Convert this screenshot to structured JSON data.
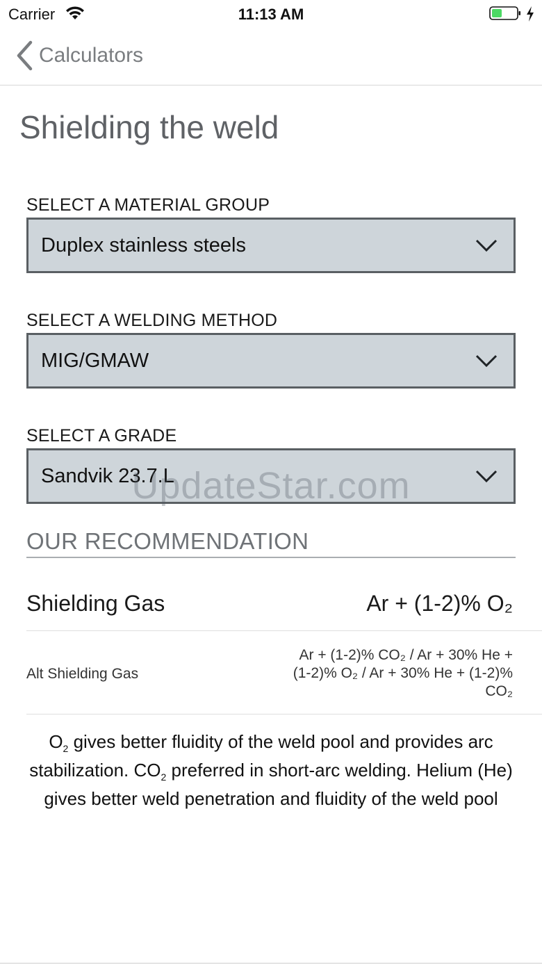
{
  "status_bar": {
    "carrier": "Carrier",
    "time": "11:13 AM"
  },
  "nav": {
    "back_label": "Calculators"
  },
  "page": {
    "title": "Shielding the weld"
  },
  "selects": [
    {
      "label": "SELECT A MATERIAL GROUP",
      "value": "Duplex stainless steels"
    },
    {
      "label": "SELECT A WELDING METHOD",
      "value": "MIG/GMAW"
    },
    {
      "label": "SELECT A GRADE",
      "value": "Sandvik 23.7.L"
    }
  ],
  "recommendation": {
    "heading": "OUR RECOMMENDATION",
    "shielding_gas_label": "Shielding Gas",
    "shielding_gas_value": "Ar + (1-2)% O₂",
    "alt_label": "Alt Shielding Gas",
    "alt_value": "Ar + (1-2)% CO₂ / Ar + 30% He + (1-2)% O₂ / Ar + 30% He + (1-2)% CO₂"
  },
  "note": {
    "p1_before": "O",
    "p1_sub": "2",
    "p1_after": " gives better fluidity of the weld pool and provides arc stabilization. CO",
    "p2_sub": "2",
    "p2_after": " preferred in short-arc welding. Helium (He) gives better weld penetration and fluidity of the weld pool"
  },
  "watermark": "UpdateStar.com",
  "colors": {
    "select_bg": "#ced5da",
    "select_border": "#5a5f63",
    "battery_fill": "#4cd964",
    "title_gray": "#5f6266"
  }
}
